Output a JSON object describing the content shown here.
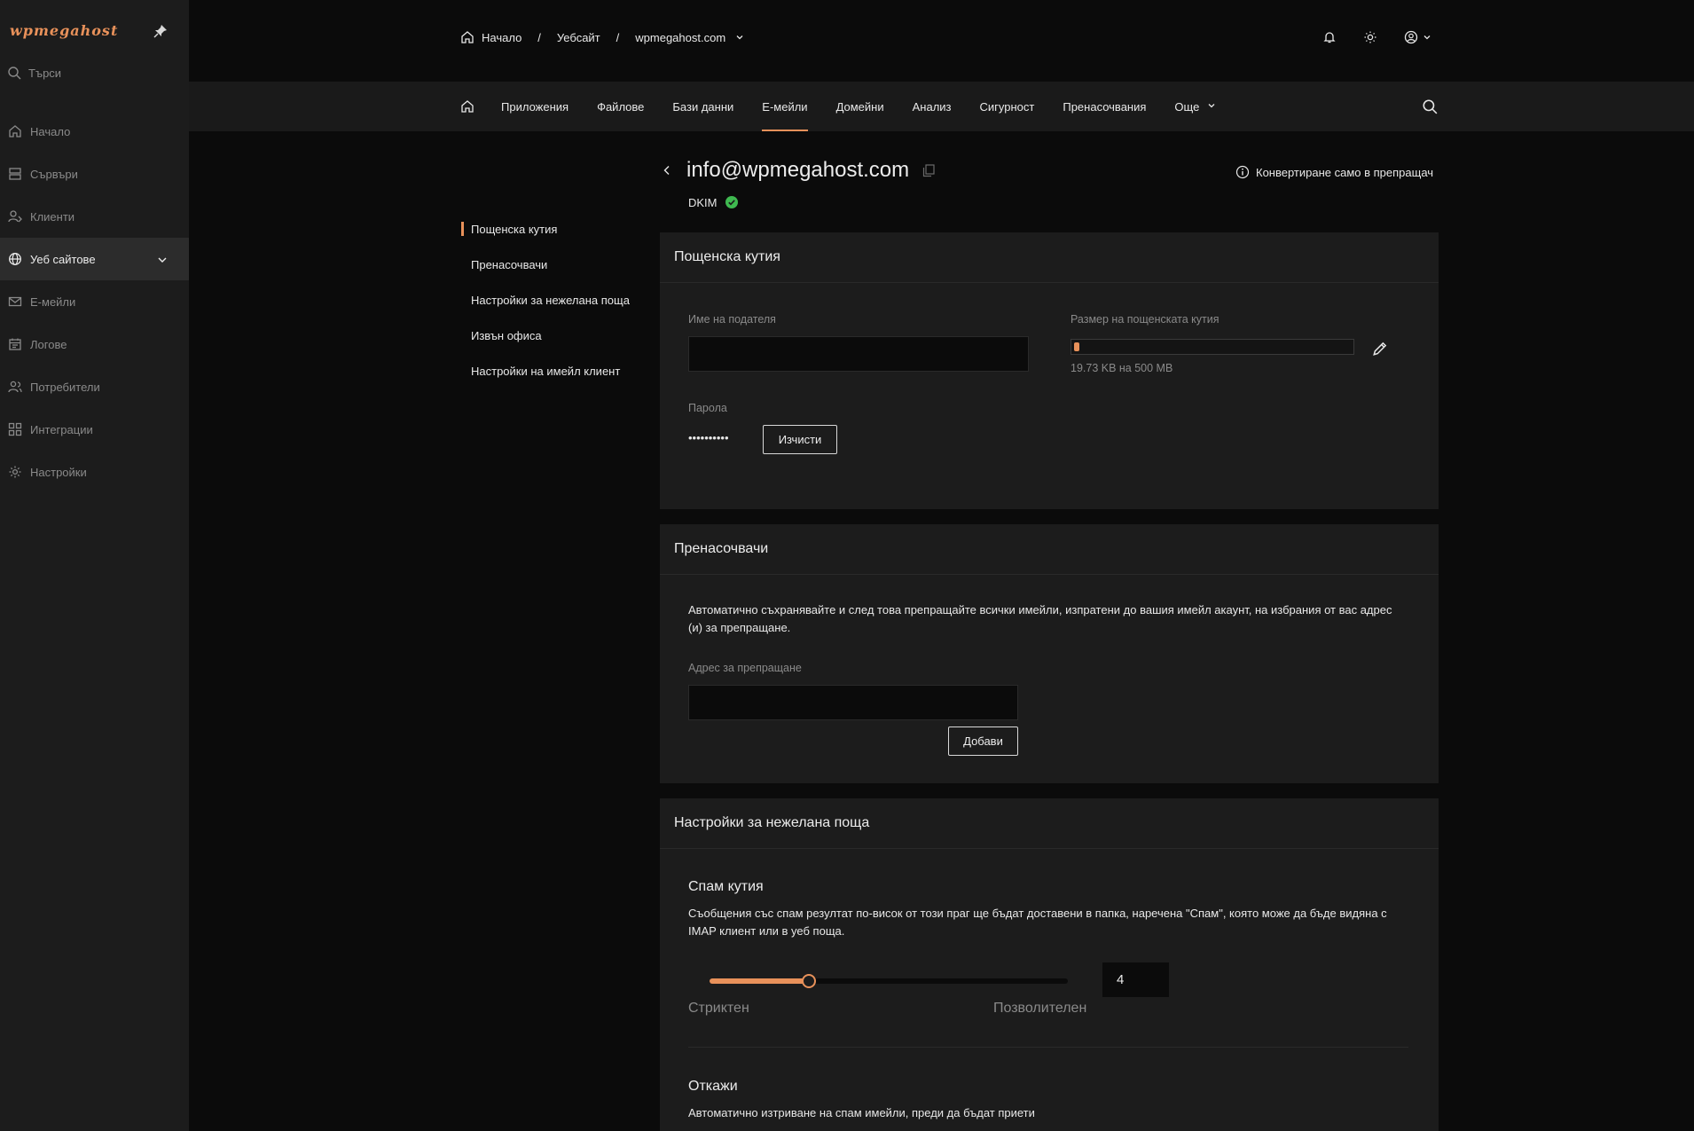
{
  "sidebar": {
    "logo": "wpmegahost",
    "search_placeholder": "Търси",
    "items": [
      {
        "label": "Начало",
        "icon": "home-icon"
      },
      {
        "label": "Сървъри",
        "icon": "server-icon"
      },
      {
        "label": "Клиенти",
        "icon": "clients-icon"
      },
      {
        "label": "Уеб сайтове",
        "icon": "globe-icon",
        "active": true
      },
      {
        "label": "Е-мейли",
        "icon": "mail-icon"
      },
      {
        "label": "Логове",
        "icon": "calendar-icon"
      },
      {
        "label": "Потребители",
        "icon": "users-icon"
      },
      {
        "label": "Интеграции",
        "icon": "integrations-icon"
      },
      {
        "label": "Настройки",
        "icon": "gear-icon"
      }
    ]
  },
  "breadcrumb": {
    "home": "Начало",
    "section": "Уебсайт",
    "site": "wpmegahost.com",
    "separator": "/"
  },
  "tabs": [
    {
      "label": "Приложения"
    },
    {
      "label": "Файлове"
    },
    {
      "label": "Бази данни"
    },
    {
      "label": "Е-мейли",
      "active": true
    },
    {
      "label": "Домейни"
    },
    {
      "label": "Анализ"
    },
    {
      "label": "Сигурност"
    },
    {
      "label": "Пренасочвания"
    },
    {
      "label": "Още"
    }
  ],
  "subnav": [
    {
      "label": "Пощенска кутия",
      "active": true
    },
    {
      "label": "Пренасочвачи"
    },
    {
      "label": "Настройки за нежелана поща"
    },
    {
      "label": "Извън офиса"
    },
    {
      "label": "Настройки на имейл клиент"
    }
  ],
  "email": {
    "address": "info@wpmegahost.com",
    "dkim_label": "DKIM",
    "convert_label": "Конвертиране само в препращач"
  },
  "mailbox": {
    "title": "Пощенска кутия",
    "sender_label": "Име на подателя",
    "sender_value": "",
    "size_label": "Размер на пощенската кутия",
    "size_text": "19.73 KB на 500 MB",
    "size_fraction": 4e-05,
    "password_label": "Парола",
    "password_mask": "••••••••••",
    "clear_button": "Изчисти"
  },
  "forwarders": {
    "title": "Пренасочвачи",
    "description": "Автоматично съхранявайте и след това препращайте всички имейли, изпратени до вашия имейл акаунт, на избрания от вас адрес (и) за препращане.",
    "address_label": "Адрес за препращане",
    "address_value": "",
    "add_button": "Добави"
  },
  "spam": {
    "title": "Настройки за нежелана поща",
    "box_title": "Спам кутия",
    "box_description": "Съобщения със спам резултат по-висок от този праг ще бъдат доставени в папка, наречена \"Спам\", която може да бъде видяна с IMAP клиент или в уеб поща.",
    "slider_value": "4",
    "slider_min_label": "Стриктен",
    "slider_max_label": "Позволителен",
    "reject_title": "Откажи",
    "reject_description": "Автоматично изтриване на спам имейли, преди да бъдат приети"
  },
  "colors": {
    "accent": "#e8915a",
    "success": "#3fb950",
    "background": "#0b0b0b",
    "card": "#1c1c1c"
  }
}
